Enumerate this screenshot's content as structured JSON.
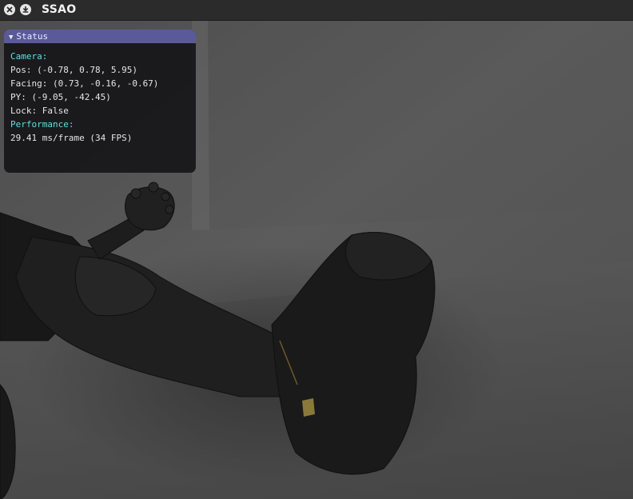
{
  "window": {
    "title": "SSAO"
  },
  "titlebar": {
    "close_icon": "close-icon",
    "minimize_icon": "download-icon"
  },
  "status": {
    "header": "Status",
    "camera_label": "Camera:",
    "pos": "Pos: (-0.78, 0.78, 5.95)",
    "facing": "Facing: (0.73, -0.16, -0.67)",
    "py": "PY: (-9.05, -42.45)",
    "lock": "Lock: False",
    "performance_label": "Performance:",
    "frame_time": "29.41 ms/frame (34 FPS)"
  },
  "colors": {
    "panel_header": "#5a5a9a",
    "section_text": "#5ee0e0",
    "body_text": "#e6e6e6",
    "titlebar": "#2b2b2b"
  }
}
